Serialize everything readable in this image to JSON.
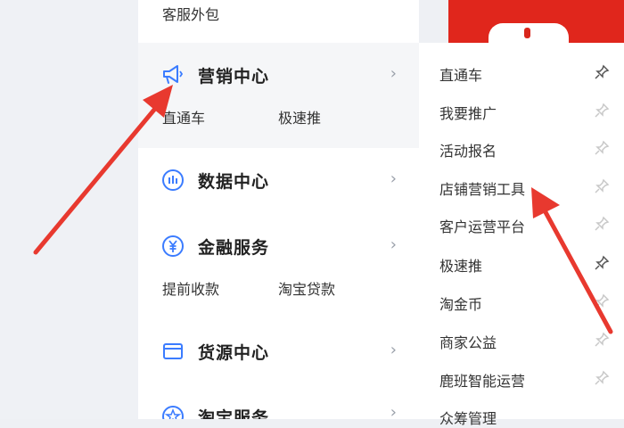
{
  "top_item": "客服外包",
  "sections": [
    {
      "title": "营销中心",
      "icon": "megaphone-icon",
      "links": [
        "直通车",
        "极速推"
      ]
    },
    {
      "title": "数据中心",
      "icon": "data-chart-icon",
      "links": []
    },
    {
      "title": "金融服务",
      "icon": "yuan-icon",
      "links": [
        "提前收款",
        "淘宝贷款"
      ]
    },
    {
      "title": "货源中心",
      "icon": "card-icon",
      "links": []
    },
    {
      "title": "淘宝服务",
      "icon": "star-icon",
      "links": []
    }
  ],
  "chevron": "›",
  "submenu": [
    "直通车",
    "我要推广",
    "活动报名",
    "店铺营销工具",
    "客户运营平台",
    "极速推",
    "淘金币",
    "商家公益",
    "鹿班智能运营",
    "众筹管理"
  ],
  "colors": {
    "accent": "#3b7cff",
    "arrow": "#e8392f",
    "banner": "#e0261c"
  }
}
